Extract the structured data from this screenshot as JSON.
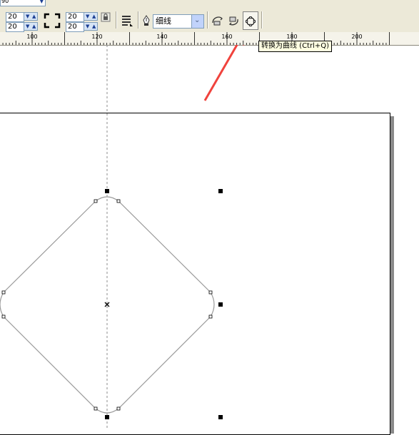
{
  "toolbar": {
    "top_dropdown_partial": "90",
    "corner_radius_fields": [
      "20",
      "20",
      "20",
      "20"
    ],
    "outline_width": "细线",
    "outline_width_options_visible": "细线"
  },
  "ruler": {
    "unit_ticks": [
      "100",
      "120",
      "140",
      "160",
      "180",
      "200"
    ]
  },
  "tooltip": {
    "text": "转换为曲线 (Ctrl+Q)"
  },
  "colors": {
    "toolbar_bg": "#ece9d8",
    "highlight": "#f0433d",
    "page_shadow": "#8a8a8a",
    "shape_stroke": "#9a9a9a"
  },
  "icons": {
    "lock_ratio": "lock-icon",
    "outline_pen": "pen-nib-icon",
    "wrap_text": "text-wrap-icon",
    "to_front": "bring-to-front-icon",
    "to_back": "send-to-back-icon",
    "convert_to_curves": "convert-to-curves-icon",
    "callout": "red-arrow-annotation"
  }
}
